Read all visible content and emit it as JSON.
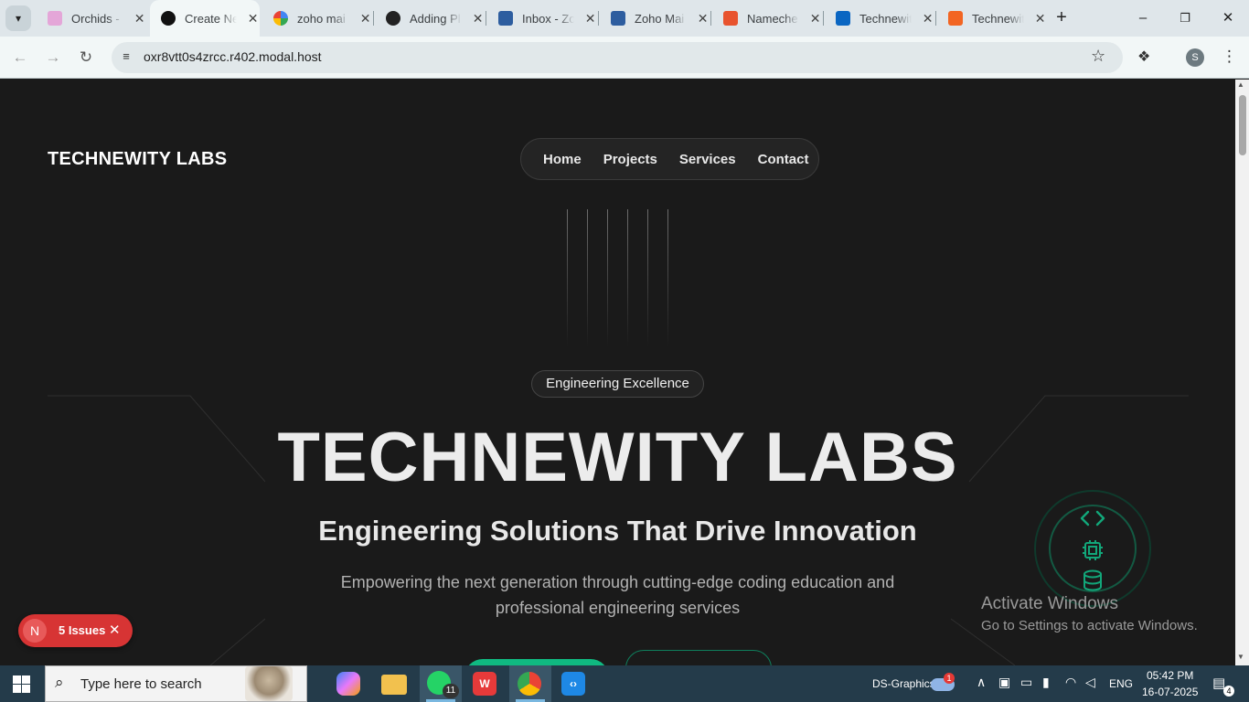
{
  "browser": {
    "tabs": [
      {
        "title": "Orchids -",
        "icon": "orchids-icon",
        "color": "#e4a6d8"
      },
      {
        "title": "Create Ne",
        "icon": "vercel-icon",
        "color": "#111111",
        "active": true
      },
      {
        "title": "zoho mai",
        "icon": "google-icon",
        "color": "#ffffff"
      },
      {
        "title": "Adding Pl",
        "icon": "openai-icon",
        "color": "#222222"
      },
      {
        "title": "Inbox - Zo",
        "icon": "mail-icon",
        "color": "#2d5d9f"
      },
      {
        "title": "Zoho Mai",
        "icon": "zoho-mail-icon",
        "color": "#2d5d9f"
      },
      {
        "title": "Nameche",
        "icon": "namecheap-icon",
        "color": "#e8532e"
      },
      {
        "title": "Technewit",
        "icon": "linkedin-icon",
        "color": "#0a66c2"
      },
      {
        "title": "Technewit",
        "icon": "orchids-logo-icon",
        "color": "#f26522"
      }
    ],
    "url": "oxr8vtt0s4zrcc.r402.modal.host",
    "profile_initial": "S"
  },
  "site": {
    "brand": "TECHNEWITY LABS",
    "nav": [
      "Home",
      "Projects",
      "Services",
      "Contact"
    ],
    "badge": "Engineering Excellence",
    "hero_title": "TECHNEWITY LABS",
    "hero_subtitle": "Engineering Solutions That Drive Innovation",
    "hero_desc_line1": "Empowering the next generation through cutting-edge coding education and",
    "hero_desc_line2": "professional engineering services",
    "accent_color": "#10b981"
  },
  "overlay": {
    "issues_initial": "N",
    "issues_label": "5 Issues",
    "activate_title": "Activate Windows",
    "activate_sub": "Go to Settings to activate Windows."
  },
  "taskbar": {
    "search_placeholder": "Type here to search",
    "whatsapp_badge": "11",
    "network_name": "DS-Graphics",
    "weather_badge": "1",
    "language": "ENG",
    "time": "05:42 PM",
    "date": "16-07-2025",
    "notifications": "4"
  }
}
